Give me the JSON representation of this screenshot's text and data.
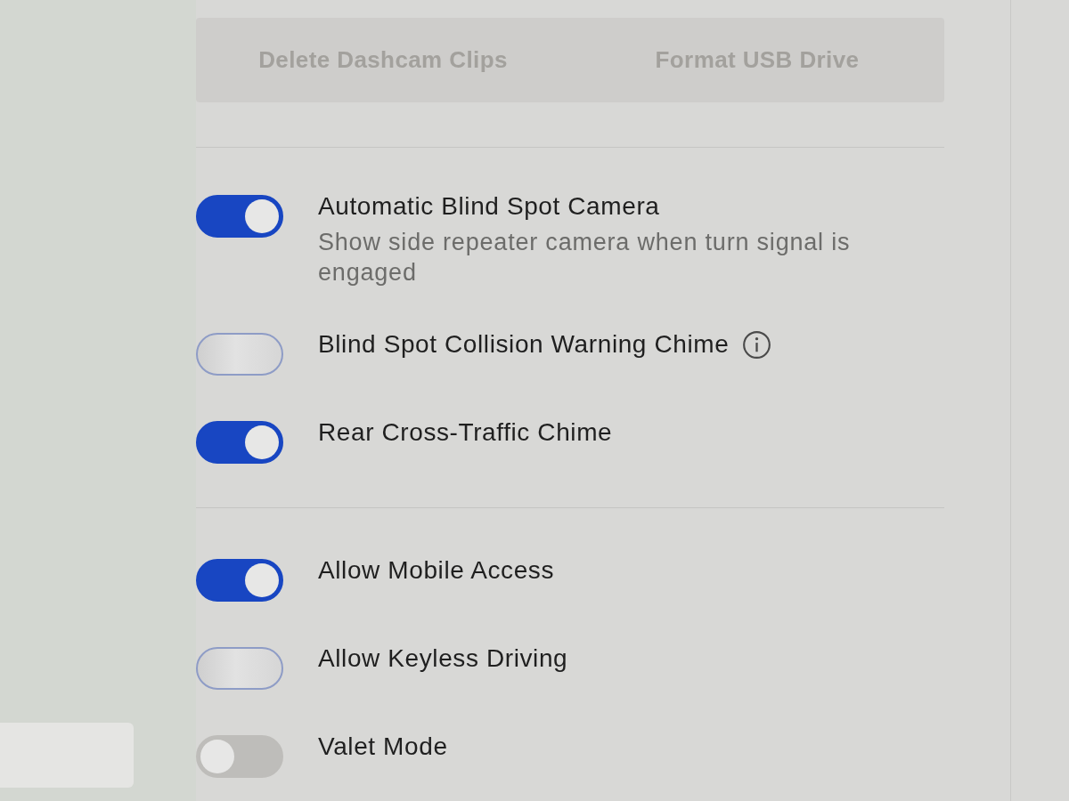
{
  "usb_actions": [
    {
      "label": "Delete Dashcam Clips",
      "disabled": true
    },
    {
      "label": "Format USB Drive",
      "disabled": true
    }
  ],
  "setting_groups": [
    {
      "settings": [
        {
          "title": "Automatic Blind Spot Camera",
          "description": "Show side repeater camera when turn signal is engaged",
          "on": true,
          "disabled": false,
          "has_info": false
        },
        {
          "title": "Blind Spot Collision Warning Chime",
          "on": false,
          "disabled": false,
          "has_info": true
        },
        {
          "title": "Rear Cross-Traffic Chime",
          "on": true,
          "disabled": false,
          "has_info": false
        }
      ]
    },
    {
      "settings": [
        {
          "title": "Allow Mobile Access",
          "on": true,
          "disabled": false,
          "has_info": false
        },
        {
          "title": "Allow Keyless Driving",
          "on": false,
          "disabled": false,
          "has_info": false
        },
        {
          "title": "Valet Mode",
          "on": false,
          "disabled": true,
          "has_info": false
        }
      ]
    }
  ]
}
